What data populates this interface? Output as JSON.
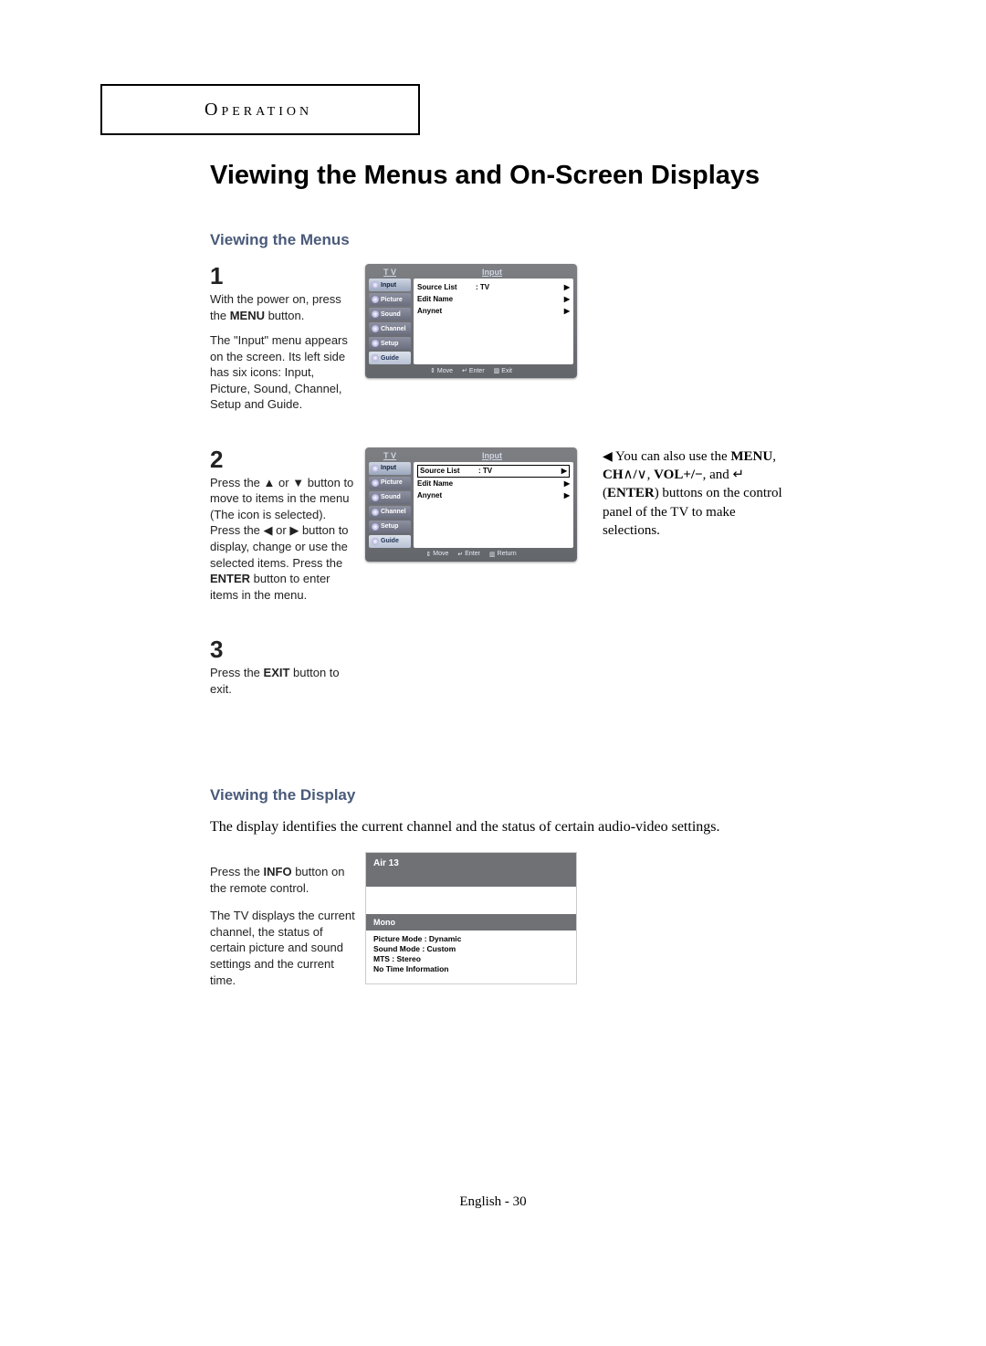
{
  "section_tab": "Operation",
  "title": "Viewing the Menus and On-Screen Displays",
  "sub1": "Viewing the Menus",
  "step1": {
    "n": "1",
    "p1a": "With the power on, press the ",
    "p1b": "MENU",
    "p1c": " button.",
    "p2": "The \"Input\" menu appears on the screen. Its left side has six icons: Input, Picture, Sound, Channel, Setup and Guide."
  },
  "step2": {
    "n": "2",
    "p_a": "Press the ",
    "p_b": " or ",
    "p_c": " button to move to items in the menu (The icon is selected). Press the ",
    "p_d": " or ",
    "p_e": " button to display, change or use the selected items. Press the ",
    "p_f": "ENTER",
    "p_g": " button to enter items in the menu."
  },
  "step3": {
    "n": "3",
    "p_a": "Press the ",
    "p_b": "EXIT",
    "p_c": " button to exit."
  },
  "tip": {
    "a": "You can also use the ",
    "menu": "MENU",
    "b": ", ",
    "ch": "CH",
    "c": ", ",
    "vol": "VOL+/−",
    "d": ", and ",
    "enter_sym": "↵",
    "enter": "ENTER",
    "e": ") buttons on the control panel of the TV to make selections."
  },
  "menu": {
    "hdr_left": "T V",
    "hdr_right": "Input",
    "side": [
      "Input",
      "Picture",
      "Sound",
      "Channel",
      "Setup",
      "Guide"
    ],
    "rows": [
      {
        "label": "Source List",
        "val": ":   TV"
      },
      {
        "label": "Edit Name",
        "val": ""
      },
      {
        "label": "Anynet",
        "val": ""
      }
    ],
    "footer1": [
      "Move",
      "Enter",
      "Exit"
    ],
    "footer2": [
      "Move",
      "Enter",
      "Return"
    ]
  },
  "sub2": "Viewing the Display",
  "display_intro": "The display identifies the current channel and the status of certain audio-video settings.",
  "info_left": {
    "a": "Press the ",
    "b": "INFO",
    "c": " button on the remote control.",
    "d": "The TV displays the current channel, the status of certain picture and sound settings and the current time."
  },
  "info": {
    "ch": "Air  13",
    "audio": "Mono",
    "lines": [
      "Picture Mode : Dynamic",
      "Sound Mode : Custom",
      "MTS : Stereo",
      "No Time Information"
    ]
  },
  "footer": "English - 30"
}
